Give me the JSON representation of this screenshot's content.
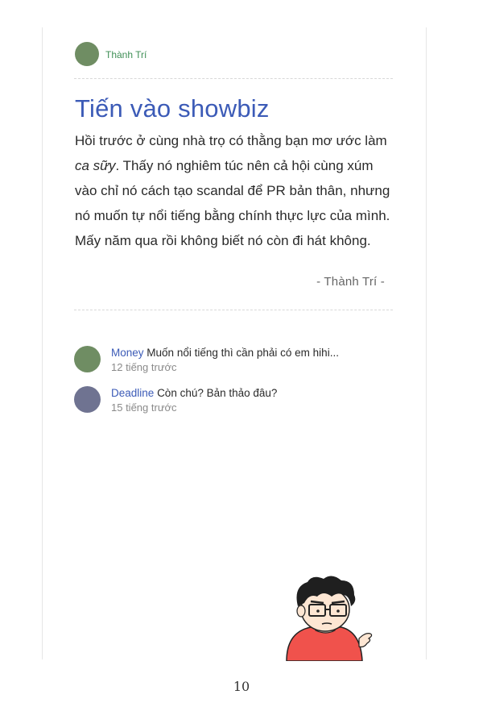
{
  "post": {
    "author": "Thành Trí",
    "title": "Tiến vào showbiz",
    "body_before_italic": "Hồi trước ở cùng nhà trọ có thằng bạn mơ ước làm ",
    "body_italic": "ca sữy",
    "body_after_italic": ". Thấy nó nghiêm túc nên cả hội cùng xúm vào chỉ nó cách tạo scandal để PR bản thân, nhưng nó muốn tự nổi tiếng bằng chính thực lực của mình. Mấy năm qua rồi không biết nó còn đi hát không.",
    "signature": "- Thành Trí -"
  },
  "comments": [
    {
      "user": "Money",
      "text": "Muốn nổi tiếng thì cần phải có em hihi...",
      "time": "12 tiếng trước"
    },
    {
      "user": "Deadline",
      "text": "Còn chú? Bản thảo đâu?",
      "time": "15 tiếng trước"
    }
  ],
  "page_number": "10",
  "colors": {
    "title": "#3c5bb7",
    "author_name": "#3f8f56",
    "avatar_author": "#6f8d63",
    "avatar_money": "#6f8d63",
    "avatar_deadline": "#6f7391",
    "shirt": "#f0524c"
  },
  "icons": {
    "author_avatar": "avatar-circle",
    "illustration": "cartoon-man-glasses"
  }
}
